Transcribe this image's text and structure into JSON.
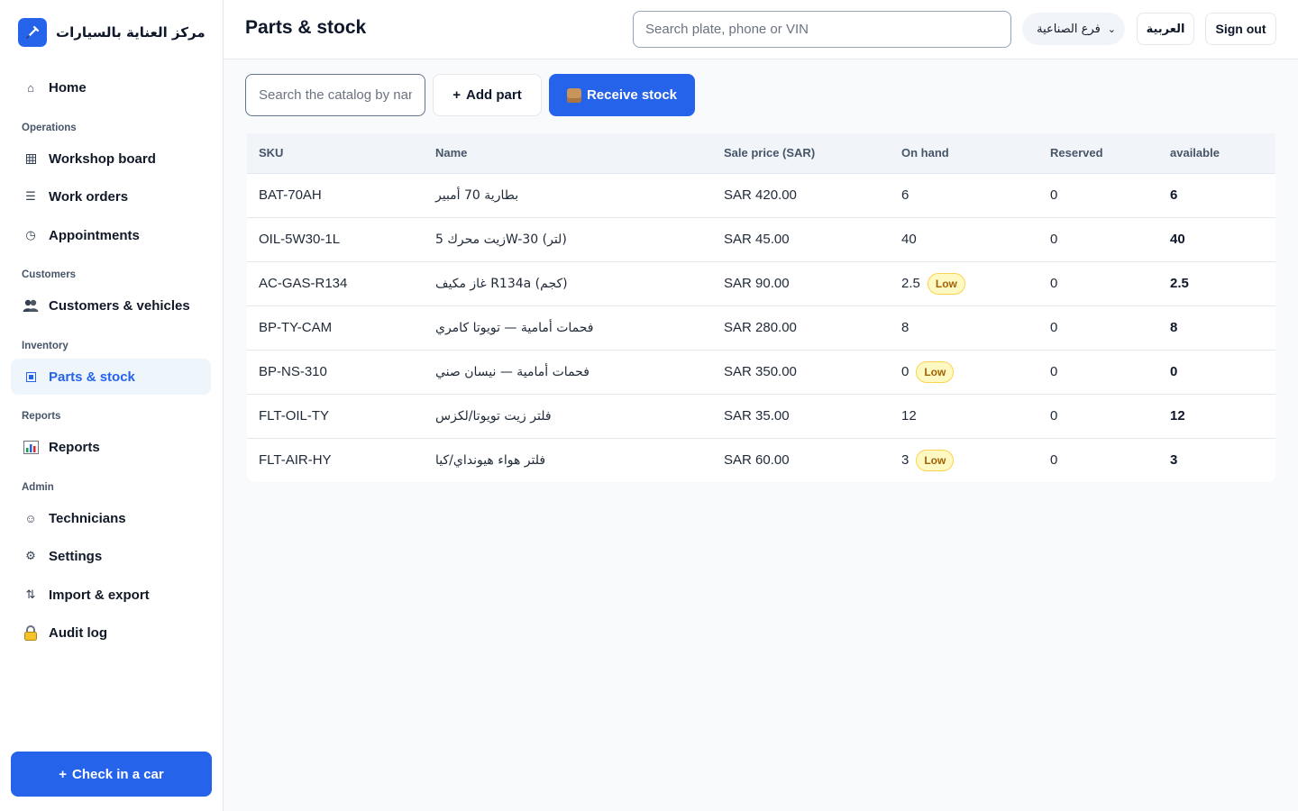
{
  "brand": {
    "name": "مركز العناية بالسيارات",
    "logo_icon": "wrench-icon",
    "logo_color": "#2563eb"
  },
  "sidebar": {
    "home": {
      "label": "Home",
      "icon": "home-icon"
    },
    "sections": [
      {
        "title": "Operations"
      },
      {
        "title": "Customers"
      },
      {
        "title": "Inventory"
      },
      {
        "title": "Reports"
      },
      {
        "title": "Admin"
      }
    ],
    "items": [
      {
        "label": "Workshop board",
        "icon": "board-icon"
      },
      {
        "label": "Work orders",
        "icon": "list-icon"
      },
      {
        "label": "Appointments",
        "icon": "clock-icon"
      },
      {
        "label": "Customers & vehicles",
        "icon": "people-icon"
      },
      {
        "label": "Parts & stock",
        "icon": "box-icon",
        "active": true
      },
      {
        "label": "Reports",
        "icon": "chart-icon"
      },
      {
        "label": "Technicians",
        "icon": "smile-icon"
      },
      {
        "label": "Settings",
        "icon": "gear-icon"
      },
      {
        "label": "Import & export",
        "icon": "swap-icon"
      },
      {
        "label": "Audit log",
        "icon": "lock-icon"
      }
    ],
    "checkin_label": "Check in a car"
  },
  "header": {
    "title": "Parts & stock",
    "search_placeholder": "Search plate, phone or VIN",
    "branch": "فرع الصناعية",
    "language": "العربية",
    "signout": "Sign out"
  },
  "toolbar": {
    "catalog_placeholder": "Search the catalog by name or SKU",
    "add_part": "Add part",
    "receive_stock": "Receive stock"
  },
  "table": {
    "columns": [
      "SKU",
      "Name",
      "Sale price (SAR)",
      "On hand",
      "Reserved",
      "available"
    ],
    "low_label": "Low",
    "rows": [
      {
        "sku": "BAT-70AH",
        "name": "بطارية 70 أمبير",
        "price": "SAR 420.00",
        "on_hand": "6",
        "low": false,
        "reserved": "0",
        "available": "6"
      },
      {
        "sku": "OIL-5W30-1L",
        "name": "زيت محرك 5W-30 (لتر)",
        "price": "SAR 45.00",
        "on_hand": "40",
        "low": false,
        "reserved": "0",
        "available": "40"
      },
      {
        "sku": "AC-GAS-R134",
        "name": "غاز مكيف R134a (كجم)",
        "price": "SAR 90.00",
        "on_hand": "2.5",
        "low": true,
        "reserved": "0",
        "available": "2.5"
      },
      {
        "sku": "BP-TY-CAM",
        "name": "فحمات أمامية — تويوتا كامري",
        "price": "SAR 280.00",
        "on_hand": "8",
        "low": false,
        "reserved": "0",
        "available": "8"
      },
      {
        "sku": "BP-NS-310",
        "name": "فحمات أمامية — نيسان صني",
        "price": "SAR 350.00",
        "on_hand": "0",
        "low": true,
        "reserved": "0",
        "available": "0"
      },
      {
        "sku": "FLT-OIL-TY",
        "name": "فلتر زيت تويوتا/لكزس",
        "price": "SAR 35.00",
        "on_hand": "12",
        "low": false,
        "reserved": "0",
        "available": "12"
      },
      {
        "sku": "FLT-AIR-HY",
        "name": "فلتر هواء هيونداي/كيا",
        "price": "SAR 60.00",
        "on_hand": "3",
        "low": true,
        "reserved": "0",
        "available": "3"
      }
    ]
  },
  "colors": {
    "accent": "#2563eb",
    "low_bg": "#fef9c3",
    "low_text": "#a16207"
  }
}
